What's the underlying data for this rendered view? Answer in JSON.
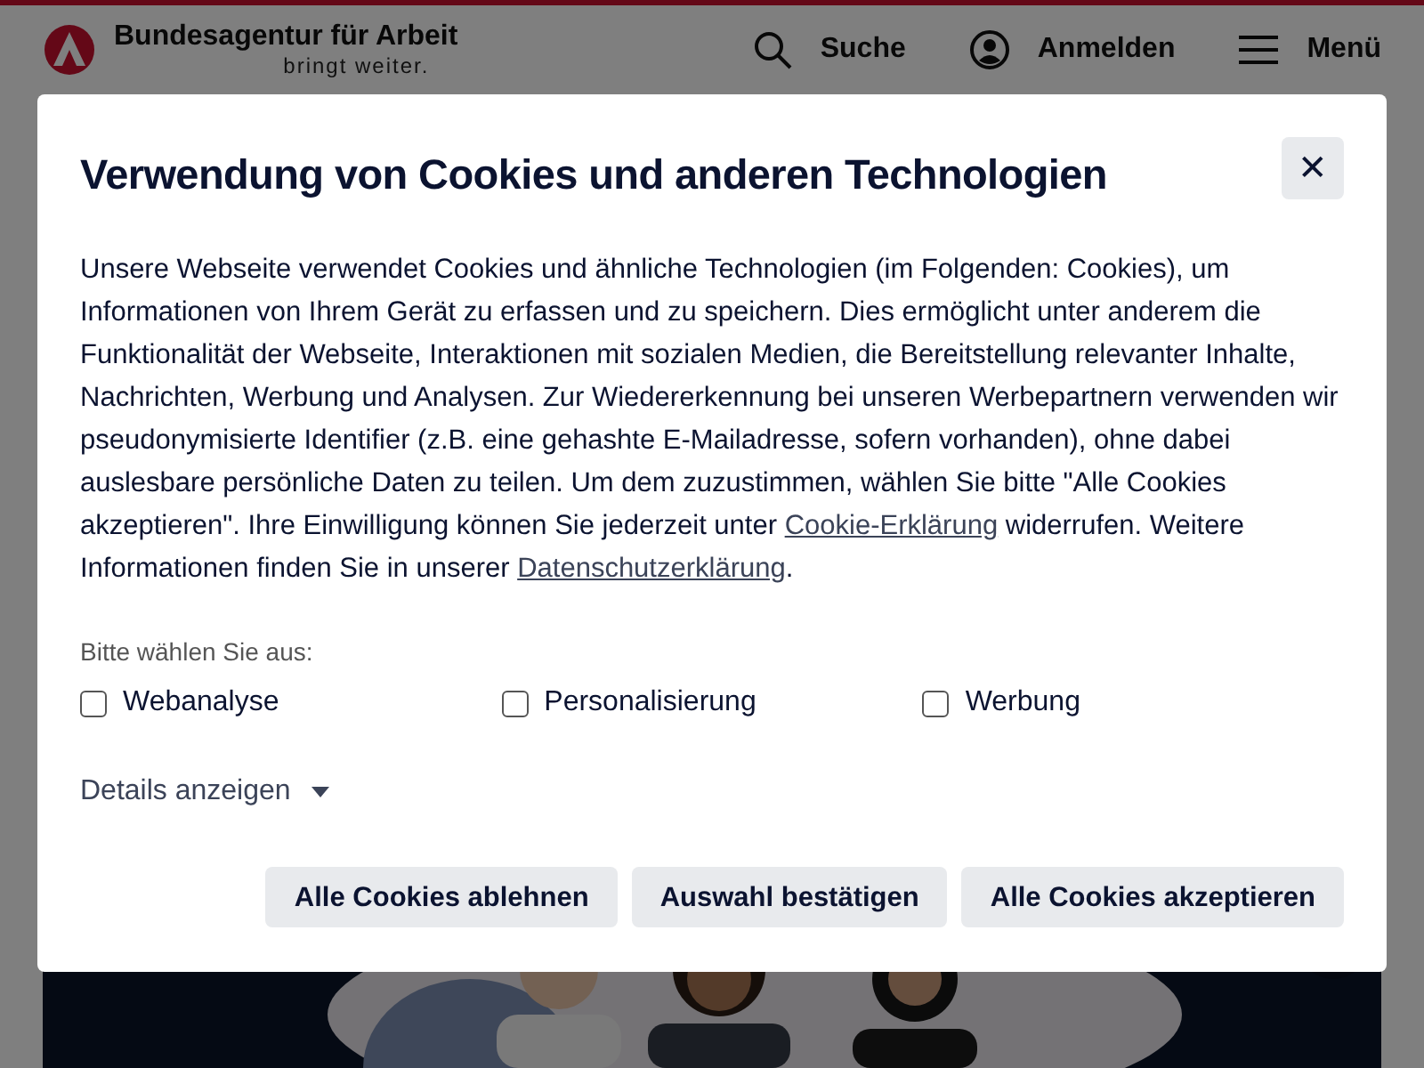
{
  "header": {
    "logo_title": "Bundesagentur für Arbeit",
    "logo_tagline": "bringt weiter.",
    "actions": [
      {
        "kind": "search",
        "label": "Suche"
      },
      {
        "kind": "login",
        "label": "Anmelden"
      },
      {
        "kind": "menu",
        "label": "Menü"
      }
    ]
  },
  "dialog": {
    "title": "Verwendung von Cookies und anderen Technologien",
    "close_label": "✕",
    "intro": [
      {
        "kind": "text",
        "text": "Unsere Webseite verwendet Cookies und ähnliche Technologien (im Folgenden: Cookies), um Informationen von Ihrem Gerät zu erfassen und zu speichern. Dies ermöglicht unter anderem die Funktionalität der Webseite, Interaktionen mit sozialen Medien, die Bereitstellung relevanter Inhalte, Nachrichten, Werbung und Analysen. Zur Wiedererkennung bei unseren Werbepartnern verwenden wir pseudonymisierte Identifier (z.B. eine gehashte E-Mailadresse, sofern vorhanden), ohne dabei auslesbare persönliche Daten zu teilen. Um dem zuzustimmen, wählen Sie bitte \"Alle Cookies akzeptieren\". Ihre Einwilligung können Sie jederzeit unter "
      },
      {
        "kind": "link",
        "text": "Cookie-Erklärung"
      },
      {
        "kind": "text",
        "text": " widerrufen. Weitere Informationen finden Sie in unserer "
      },
      {
        "kind": "link",
        "text": "Datenschutzerklärung"
      },
      {
        "kind": "text",
        "text": "."
      }
    ],
    "choose_label": "Bitte wählen Sie aus:",
    "options": [
      {
        "label": "Webanalyse",
        "checked": false
      },
      {
        "label": "Personalisierung",
        "checked": false
      },
      {
        "label": "Werbung",
        "checked": false
      }
    ],
    "details": {
      "label": "Details anzeigen",
      "expanded": false
    },
    "buttons": [
      "Alle Cookies ablehnen",
      "Auswahl bestätigen",
      "Alle Cookies akzeptieren"
    ]
  }
}
